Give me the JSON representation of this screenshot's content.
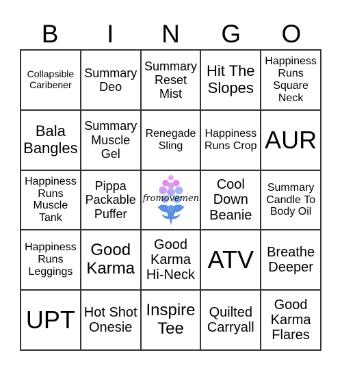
{
  "header": {
    "letters": [
      "B",
      "I",
      "N",
      "G",
      "O"
    ]
  },
  "free_space": {
    "logo_text": "fromovement",
    "icon": "floral-logo-icon",
    "colors": {
      "pink": "#e58be8",
      "lavender": "#b9a6ee",
      "blue": "#5b8fe0"
    }
  },
  "cells": [
    "Collapsible Caribener",
    "Summary Deo",
    "Summary Reset Mist",
    "Hit The Slopes",
    "Happiness Runs Square Neck",
    "Bala Bangles",
    "Summary Muscle Gel",
    "Renegade Sling",
    "Happiness Runs Crop",
    "AUR",
    "Happiness Runs Muscle Tank",
    "Pippa Packable Puffer",
    "",
    "Cool Down Beanie",
    "Summary Candle To Body Oil",
    "Happiness Runs Leggings",
    "Good Karma",
    "Good Karma Hi-Neck",
    "ATV",
    "Breathe Deeper",
    "UPT",
    "Hot Shot Onesie",
    "Inspire Tee",
    "Quilted Carryall",
    "Good Karma Flares"
  ]
}
